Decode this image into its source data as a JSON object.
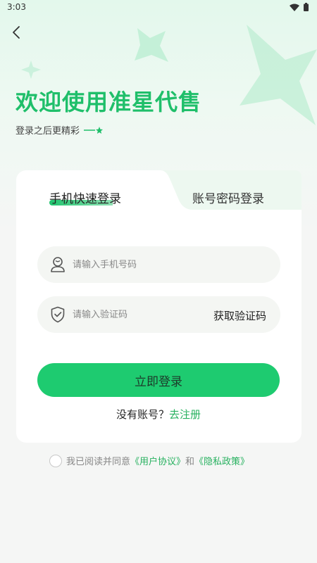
{
  "status": {
    "time": "3:03"
  },
  "header": {
    "welcome": "欢迎使用准星代售",
    "subtitle": "登录之后更精彩"
  },
  "tabs": {
    "phone": "手机快速登录",
    "password": "账号密码登录"
  },
  "form": {
    "phone_placeholder": "请输入手机号码",
    "code_placeholder": "请输入验证码",
    "get_code": "获取验证码",
    "login": "立即登录"
  },
  "register": {
    "question": "没有账号？",
    "link": "去注册"
  },
  "agreement": {
    "prefix": "我已阅读并同意",
    "user_agreement": "《用户协议》",
    "and": "和",
    "privacy_policy": "《隐私政策》"
  },
  "colors": {
    "accent": "#1ecb70",
    "title": "#1fbf6a",
    "link": "#27b15f"
  }
}
